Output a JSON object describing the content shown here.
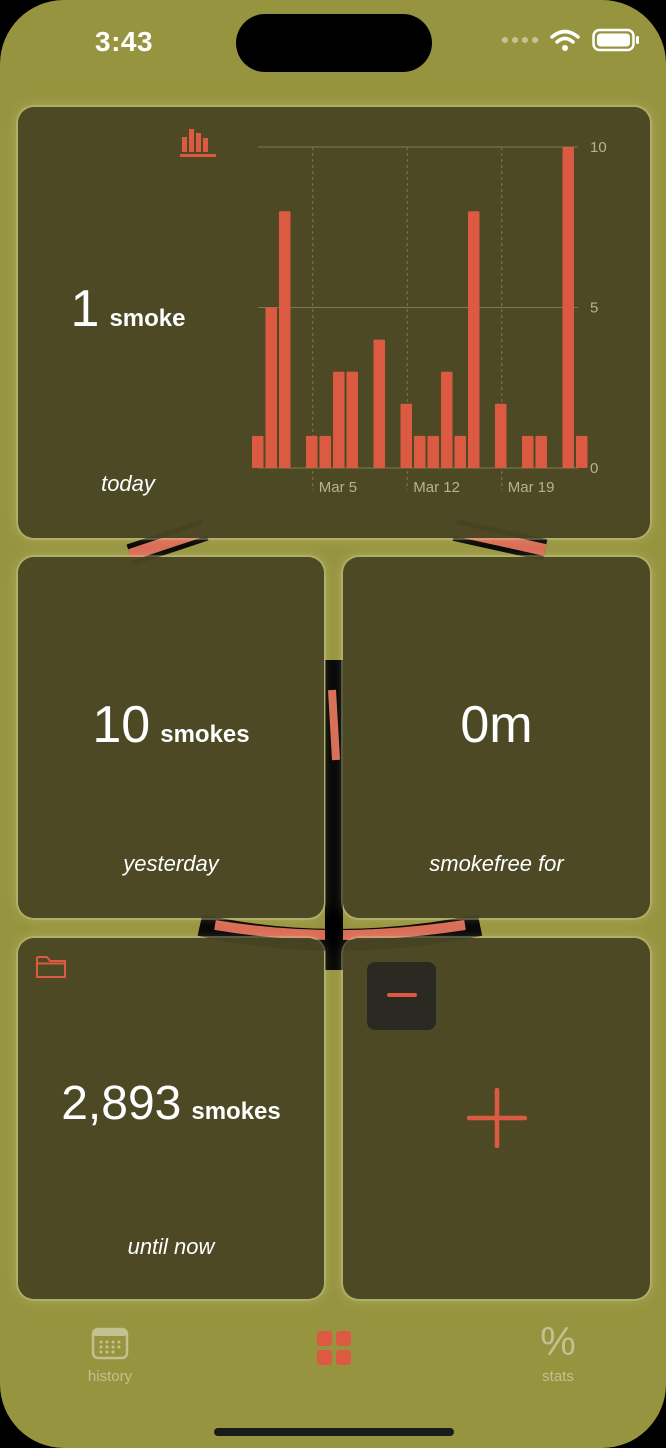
{
  "status": {
    "time": "3:43"
  },
  "today": {
    "value": "1",
    "unit": "smoke",
    "caption": "today",
    "icon": "bar-chart-icon"
  },
  "chart_data": {
    "type": "bar",
    "x_labels": [
      "Mar 5",
      "Mar 12",
      "Mar 19"
    ],
    "values": [
      1,
      5,
      8,
      0,
      1,
      1,
      3,
      3,
      0,
      4,
      0,
      2,
      1,
      1,
      3,
      1,
      8,
      0,
      2,
      0,
      1,
      1,
      0,
      10,
      1
    ],
    "ylim": [
      0,
      10
    ],
    "y_ticks": [
      "10",
      "5",
      "0"
    ],
    "bar_color": "#dc5a42"
  },
  "yesterday": {
    "value": "10",
    "unit": "smokes",
    "caption": "yesterday"
  },
  "smokefree": {
    "value": "0m",
    "caption": "smokefree for"
  },
  "total": {
    "value": "2,893",
    "unit": "smokes",
    "caption": "until now",
    "icon": "folder-icon"
  },
  "actions": {
    "minus_icon": "minus-icon",
    "plus_icon": "plus-icon"
  },
  "tabs": [
    {
      "label": "history",
      "icon": "calendar-icon"
    },
    {
      "label": "",
      "icon": "grid-icon"
    },
    {
      "label": "stats",
      "icon": "percent-icon"
    }
  ],
  "colors": {
    "background": "#97943f",
    "tile": "#494623",
    "accent": "#dc5a42"
  }
}
